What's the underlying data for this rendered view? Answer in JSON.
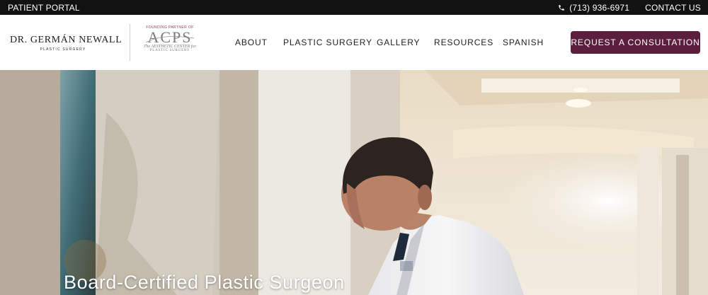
{
  "topbar": {
    "patient_portal": "PATIENT PORTAL",
    "phone": "(713) 936-6971",
    "contact": "CONTACT US"
  },
  "logo": {
    "name": "DR. GERMÁN NEWALL",
    "sub": "PLASTIC SURGERY"
  },
  "partner_logo": {
    "founding": "FOUNDING PARTNER OF",
    "letters": "ACPS",
    "tagline1": "The AESTHETIC CENTER for",
    "tagline2": "PLASTIC SURGERY"
  },
  "nav": {
    "items": [
      {
        "label": "ABOUT"
      },
      {
        "label": "PLASTIC SURGERY"
      },
      {
        "label": "GALLERY"
      },
      {
        "label": "RESOURCES"
      },
      {
        "label": "SPANISH"
      }
    ]
  },
  "cta": {
    "label": "REQUEST A CONSULTATION"
  },
  "hero": {
    "title": "Board-Certified Plastic Surgeon"
  },
  "colors": {
    "topbar_bg": "#121212",
    "cta_bg": "#5b1e3d",
    "nav_text": "#222222"
  },
  "icons": {
    "phone": "phone-icon"
  }
}
